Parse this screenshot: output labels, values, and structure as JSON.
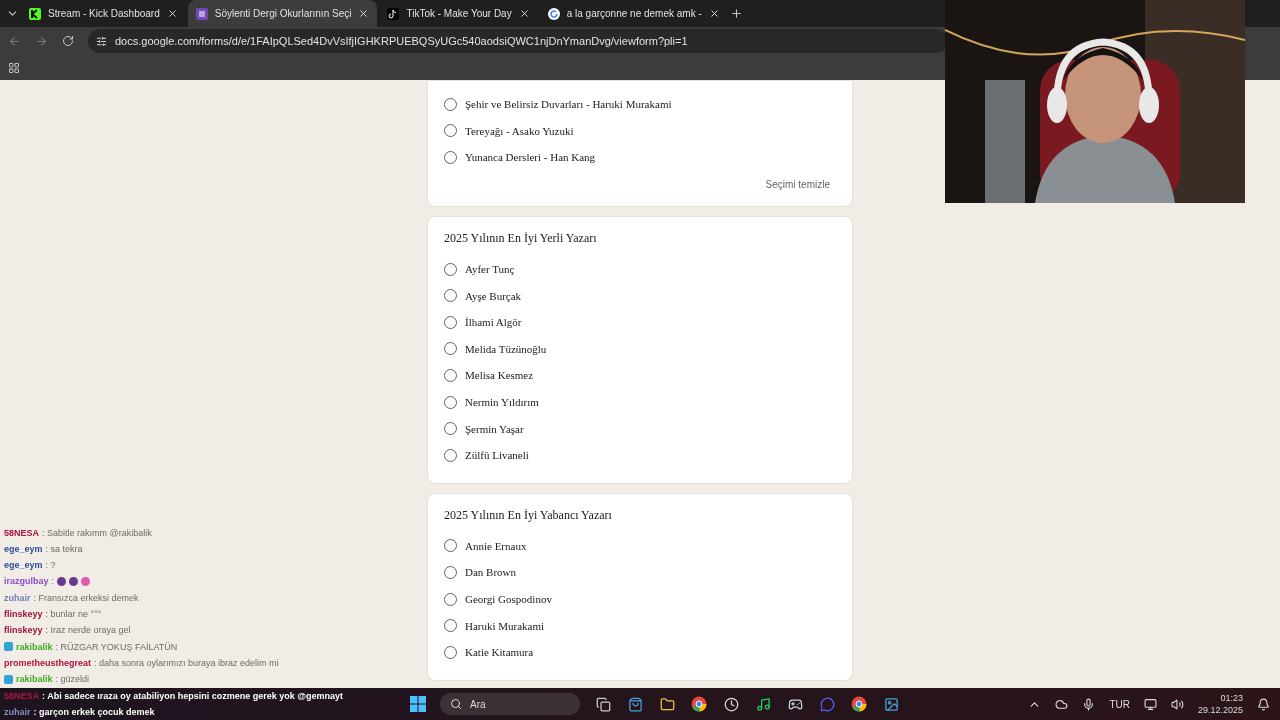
{
  "tabs": [
    {
      "title": "Stream - Kick Dashboard",
      "selected": false
    },
    {
      "title": "Söylenti Dergi Okurlarının Seçi",
      "selected": true
    },
    {
      "title": "TikTok - Make Your Day",
      "selected": false
    },
    {
      "title": "a la garçonne ne demek amk -",
      "selected": false
    }
  ],
  "address_bar": {
    "url": "docs.google.com/forms/d/e/1FAIpQLSed4DvVsIfjIGHKRPUEBQSyUGc540aodsiQWC1njDnYmanDvg/viewform?pli=1"
  },
  "questions": [
    {
      "options": [
        {
          "label": "Şehir ve Belirsiz Duvarları - Haruki Murakami",
          "selected": false
        },
        {
          "label": "Tereyağı - Asako Yuzuki",
          "selected": false
        },
        {
          "label": "Yunanca Dersleri - Han Kang",
          "selected": false
        }
      ],
      "clear_button": "Seçimi temizle"
    },
    {
      "title": "2025 Yılının En İyi Yerli Yazarı",
      "options": [
        {
          "label": "Ayfer Tunç",
          "selected": false
        },
        {
          "label": "Ayşe Burçak",
          "selected": false
        },
        {
          "label": "İlhami Algör",
          "selected": false
        },
        {
          "label": "Melida Tüzünoğlu",
          "selected": false
        },
        {
          "label": "Melisa Kesmez",
          "selected": false
        },
        {
          "label": "Nermin Yıldırım",
          "selected": false
        },
        {
          "label": "Şermin Yaşar",
          "selected": false
        },
        {
          "label": "Zülfü Livaneli",
          "selected": false
        }
      ]
    },
    {
      "title": "2025 Yılının En İyi Yabancı Yazarı",
      "options": [
        {
          "label": "Annie Ernaux",
          "selected": false
        },
        {
          "label": "Dan Brown",
          "selected": false
        },
        {
          "label": "Georgi Gospodinov",
          "selected": false
        },
        {
          "label": "Haruki Murakami",
          "selected": false
        },
        {
          "label": "Katie Kitamura",
          "selected": false
        }
      ]
    }
  ],
  "chat": [
    {
      "kind": "text",
      "user": "58NESA",
      "color": "#b0123a",
      "badge": false,
      "text": ": Sabitle rakımm @rakibalik"
    },
    {
      "kind": "text",
      "user": "ege_eym",
      "color": "#2a4f9a",
      "badge": false,
      "text": ": sa tekra"
    },
    {
      "kind": "text",
      "user": "ege_eym",
      "color": "#2a4f9a",
      "badge": false,
      "text": ": ?"
    },
    {
      "kind": "emotes",
      "user": "irazgulbay",
      "color": "#8a4fc8",
      "badge": false,
      "text": ":"
    },
    {
      "kind": "text",
      "user": "zuhair",
      "color": "#6f7fb8",
      "badge": false,
      "text": ": Fransızca erkeksi demek"
    },
    {
      "kind": "text",
      "user": "flinskeyy",
      "color": "#a0123a",
      "badge": false,
      "text": ": bunlar ne °°°"
    },
    {
      "kind": "text",
      "user": "flinskeyy",
      "color": "#a0123a",
      "badge": false,
      "text": ": Iraz nerde oraya gel"
    },
    {
      "kind": "text",
      "user": "rakibalik",
      "color": "#3fae1f",
      "badge": true,
      "text": ": RÜZGAR YOKUŞ FAİLATÜN"
    },
    {
      "kind": "text",
      "user": "prometheusthegreat",
      "color": "#b0123a",
      "badge": false,
      "text": ": daha sonra oylarımızı buraya ibraz edelim mi"
    },
    {
      "kind": "text",
      "user": "rakibalik",
      "color": "#3fae1f",
      "badge": true,
      "text": ": güzeldi"
    },
    {
      "kind": "text",
      "user": "58NESA",
      "color": "#b0123a",
      "badge": false,
      "text": ": Abi sadece ıraza oy atabiliyon hepsini cozmene gerek yok @gemnayt"
    },
    {
      "kind": "text",
      "user": "zuhair",
      "color": "#7f8fc0",
      "badge": false,
      "text": ": garçon erkek çocuk demek"
    }
  ],
  "taskbar": {
    "search_placeholder": "Ara",
    "language": "TUR",
    "time": "01:23",
    "date": "29.12.2025"
  }
}
